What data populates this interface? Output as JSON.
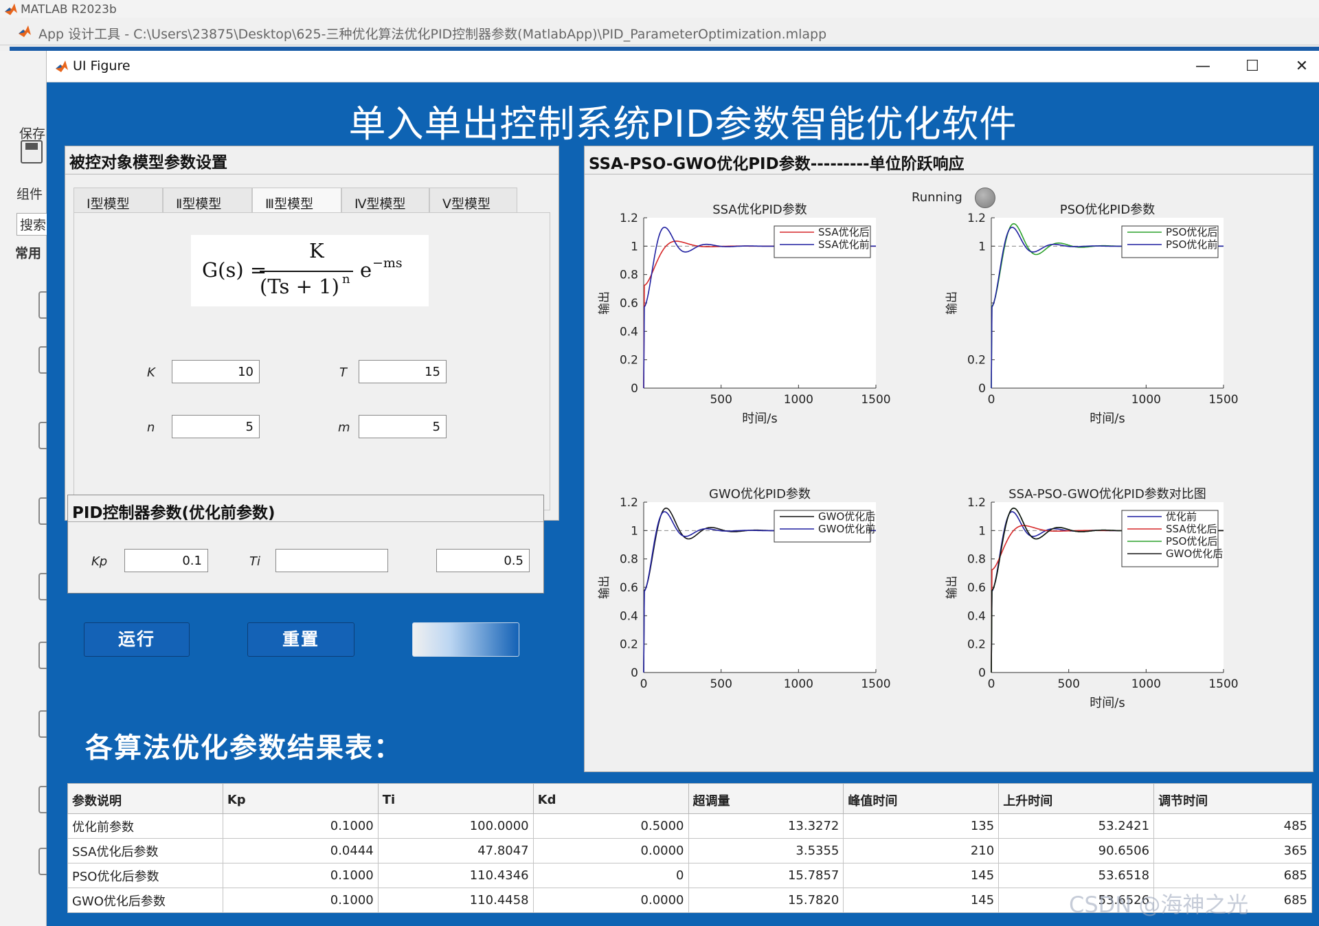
{
  "window": {
    "matlab_title": "MATLAB R2023b",
    "app_title": "App 设计工具 - C:\\Users\\23875\\Desktop\\625-三种优化算法优化PID控制器参数(MatlabApp)\\PID_ParameterOptimization.mlapp",
    "figure_title": "UI Figure",
    "minimize": "—",
    "maximize": "☐",
    "close": "✕"
  },
  "sidebar": {
    "save_label": "保存",
    "components_label": "组件",
    "search_label": "搜索",
    "common_label": "常用"
  },
  "app": {
    "heading": "单入单出控制系统PID参数智能优化软件"
  },
  "model_panel": {
    "title": "被控对象模型参数设置",
    "tabs": [
      "Ⅰ型模型",
      "Ⅱ型模型",
      "Ⅲ型模型",
      "Ⅳ型模型",
      "Ⅴ型模型"
    ],
    "active_tab": 2,
    "formula": {
      "lhs": "G(s) =",
      "numerator": "K",
      "denominator": "(Ts + 1)",
      "den_exp": "n",
      "exp_base": "e",
      "exp_power": "−ms"
    },
    "fields": {
      "K": {
        "label": "K",
        "value": "10"
      },
      "T": {
        "label": "T",
        "value": "15"
      },
      "n": {
        "label": "n",
        "value": "5"
      },
      "m": {
        "label": "m",
        "value": "5"
      }
    }
  },
  "pid_panel": {
    "title": "PID控制器参数(优化前参数)",
    "fields": {
      "Kp": {
        "label": "Kp",
        "value": "0.1"
      },
      "Ti": {
        "label": "Ti",
        "value": ""
      },
      "Kd": {
        "label": "",
        "value": "0.5"
      }
    }
  },
  "buttons": {
    "run": "运行",
    "reset": "重置"
  },
  "results_heading": "各算法优化参数结果表：",
  "response_panel": {
    "title": "SSA-PSO-GWO优化PID参数---------单位阶跃响应",
    "status_label": "Running",
    "status_lamp": "off"
  },
  "chart_data": [
    {
      "type": "line",
      "title": "SSA优化PID参数",
      "xlabel": "时间/s",
      "ylabel": "输出",
      "xlim": [
        0,
        1500
      ],
      "ylim": [
        0,
        1.2
      ],
      "yticks": [
        "0",
        "0.2",
        "0.4",
        "0.6",
        "0.8",
        "1",
        "1.2"
      ],
      "xticks": [
        "500",
        "1000",
        "1500"
      ],
      "legend": [
        "SSA优化后",
        "SSA优化前"
      ],
      "legend_position": "top-right",
      "series": [
        {
          "name": "SSA优化后",
          "color": "#d62728",
          "overshoot": 0.035,
          "peak_time": 210,
          "rise_time": 90,
          "damping": 0.55
        },
        {
          "name": "SSA优化前",
          "color": "#1f1fa0",
          "overshoot": 0.133,
          "peak_time": 135,
          "rise_time": 53,
          "damping": 0.35
        }
      ]
    },
    {
      "type": "line",
      "title": "PSO优化PID参数",
      "xlabel": "时间/s",
      "ylabel": "输出",
      "xlim": [
        0,
        1500
      ],
      "ylim": [
        0,
        1.2
      ],
      "yticks": [
        "0",
        "0.2",
        "",
        "",
        "",
        "1",
        "1.2"
      ],
      "xticks": [
        "0",
        "1000",
        "1500"
      ],
      "legend": [
        "PSO优化后",
        "PSO优化前"
      ],
      "legend_position": "top-right",
      "series": [
        {
          "name": "PSO优化后",
          "color": "#2ca02c",
          "overshoot": 0.158,
          "peak_time": 145,
          "rise_time": 54,
          "damping": 0.3
        },
        {
          "name": "PSO优化前",
          "color": "#1f1fa0",
          "overshoot": 0.133,
          "peak_time": 135,
          "rise_time": 53,
          "damping": 0.35
        }
      ]
    },
    {
      "type": "line",
      "title": "GWO优化PID参数",
      "xlabel": "",
      "ylabel": "输出",
      "xlim": [
        0,
        1500
      ],
      "ylim": [
        0,
        1.2
      ],
      "yticks": [
        "0",
        "0.2",
        "0.4",
        "0.6",
        "0.8",
        "1",
        "1.2"
      ],
      "xticks": [
        "0",
        "500",
        "1000",
        "1500"
      ],
      "legend": [
        "GWO优化后",
        "GWO优化前"
      ],
      "legend_position": "top-right",
      "series": [
        {
          "name": "GWO优化后",
          "color": "#111111",
          "overshoot": 0.158,
          "peak_time": 145,
          "rise_time": 54,
          "damping": 0.3
        },
        {
          "name": "GWO优化前",
          "color": "#1f1fa0",
          "overshoot": 0.133,
          "peak_time": 135,
          "rise_time": 53,
          "damping": 0.35
        }
      ]
    },
    {
      "type": "line",
      "title": "SSA-PSO-GWO优化PID参数对比图",
      "xlabel": "时间/s",
      "ylabel": "输出",
      "xlim": [
        0,
        1500
      ],
      "ylim": [
        0,
        1.2
      ],
      "yticks": [
        "0",
        "0.2",
        "0.4",
        "0.6",
        "0.8",
        "1",
        "1.2"
      ],
      "xticks": [
        "0",
        "500",
        "1000",
        "1500"
      ],
      "legend": [
        "优化前",
        "SSA优化后",
        "PSO优化后",
        "GWO优化后"
      ],
      "legend_position": "top-right",
      "series": [
        {
          "name": "优化前",
          "color": "#1f1fa0",
          "overshoot": 0.133,
          "peak_time": 135,
          "rise_time": 53,
          "damping": 0.35
        },
        {
          "name": "SSA优化后",
          "color": "#d62728",
          "overshoot": 0.035,
          "peak_time": 210,
          "rise_time": 90,
          "damping": 0.55
        },
        {
          "name": "PSO优化后",
          "color": "#2ca02c",
          "overshoot": 0.158,
          "peak_time": 145,
          "rise_time": 54,
          "damping": 0.3
        },
        {
          "name": "GWO优化后",
          "color": "#111111",
          "overshoot": 0.158,
          "peak_time": 145,
          "rise_time": 54,
          "damping": 0.3
        }
      ]
    }
  ],
  "results_table": {
    "columns": [
      "参数说明",
      "Kp",
      "Ti",
      "Kd",
      "超调量",
      "峰值时间",
      "上升时间",
      "调节时间"
    ],
    "rows": [
      [
        "优化前参数",
        "0.1000",
        "100.0000",
        "0.5000",
        "13.3272",
        "135",
        "53.2421",
        "485"
      ],
      [
        "SSA优化后参数",
        "0.0444",
        "47.8047",
        "0.0000",
        "3.5355",
        "210",
        "90.6506",
        "365"
      ],
      [
        "PSO优化后参数",
        "0.1000",
        "110.4346",
        "0",
        "15.7857",
        "145",
        "53.6518",
        "685"
      ],
      [
        "GWO优化后参数",
        "0.1000",
        "110.4458",
        "0.0000",
        "15.7820",
        "145",
        "53.6526",
        "685"
      ]
    ]
  },
  "watermark": "CSDN @海神之光",
  "colors": {
    "accent": "#0e63b3",
    "button": "#1462b6"
  }
}
